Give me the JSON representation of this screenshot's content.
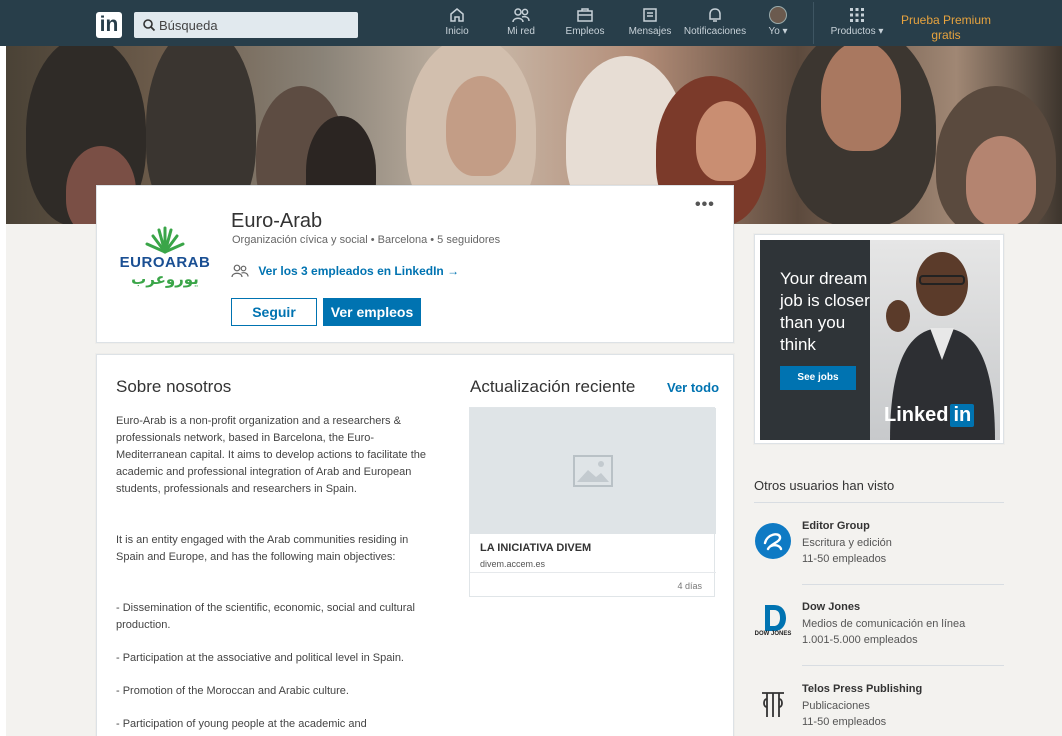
{
  "nav": {
    "logo": "in",
    "search_placeholder": "Búsqueda",
    "items": [
      {
        "label": "Inicio",
        "icon": "home-icon"
      },
      {
        "label": "Mi red",
        "icon": "network-icon"
      },
      {
        "label": "Empleos",
        "icon": "briefcase-icon"
      },
      {
        "label": "Mensajes",
        "icon": "messages-icon"
      },
      {
        "label": "Notificaciones",
        "icon": "bell-icon"
      },
      {
        "label": "Yo ▾",
        "icon": "avatar"
      },
      {
        "label": "Productos ▾",
        "icon": "grid-icon"
      }
    ],
    "premium_line1": "Prueba Premium",
    "premium_line2": "gratis"
  },
  "company": {
    "name": "Euro-Arab",
    "meta": "Organización cívica y social  •  Barcelona  •  5 seguidores",
    "employees_link": "Ver los 3 empleados en LinkedIn →",
    "follow_label": "Seguir",
    "jobs_label": "Ver empleos",
    "logo_text": "EUROARAB",
    "logo_arabic": "يوروعرب"
  },
  "about": {
    "title": "Sobre nosotros",
    "paragraphs": [
      "Euro-Arab is a non-profit organization and a researchers & professionals network, based in Barcelona, the Euro-Mediterranean capital. It aims to develop actions to facilitate the academic and professional integration of Arab and European students, professionals and researchers in Spain.",
      "It is an entity engaged with the Arab communities residing in Spain and Europe, and has the following main objectives:",
      "- Dissemination of the scientific, economic, social and cultural production.",
      "- Participation at the associative and political level in Spain.",
      "- Promotion of the Moroccan and Arabic culture.",
      "- Participation of young people at the academic and entrepreneurial level."
    ]
  },
  "updates": {
    "title": "Actualización reciente",
    "see_all": "Ver todo",
    "post_title": "LA INICIATIVA DIVEM",
    "post_url": "divem.accem.es",
    "post_time": "4 días"
  },
  "ad": {
    "line1": "Your dream",
    "line2": "job is closer",
    "line3": "than you",
    "line4": "think",
    "button": "See jobs",
    "brand": "Linked",
    "brand_in": "in"
  },
  "others": {
    "title": "Otros usuarios han visto",
    "companies": [
      {
        "name": "Editor Group",
        "industry": "Escritura y edición",
        "size": "11-50 empleados",
        "color": "#0e7ac4"
      },
      {
        "name": "Dow Jones",
        "industry": "Medios de comunicación en línea",
        "size": "1.001-5.000 empleados",
        "logo_caption": "DOW JONES",
        "color": "#0073b1"
      },
      {
        "name": "Telos Press Publishing",
        "industry": "Publicaciones",
        "size": "11-50 empleados",
        "color": "#333333"
      }
    ]
  },
  "colors": {
    "nav": "#283e4a",
    "accent": "#0073b1",
    "premium": "#e7a33e"
  }
}
